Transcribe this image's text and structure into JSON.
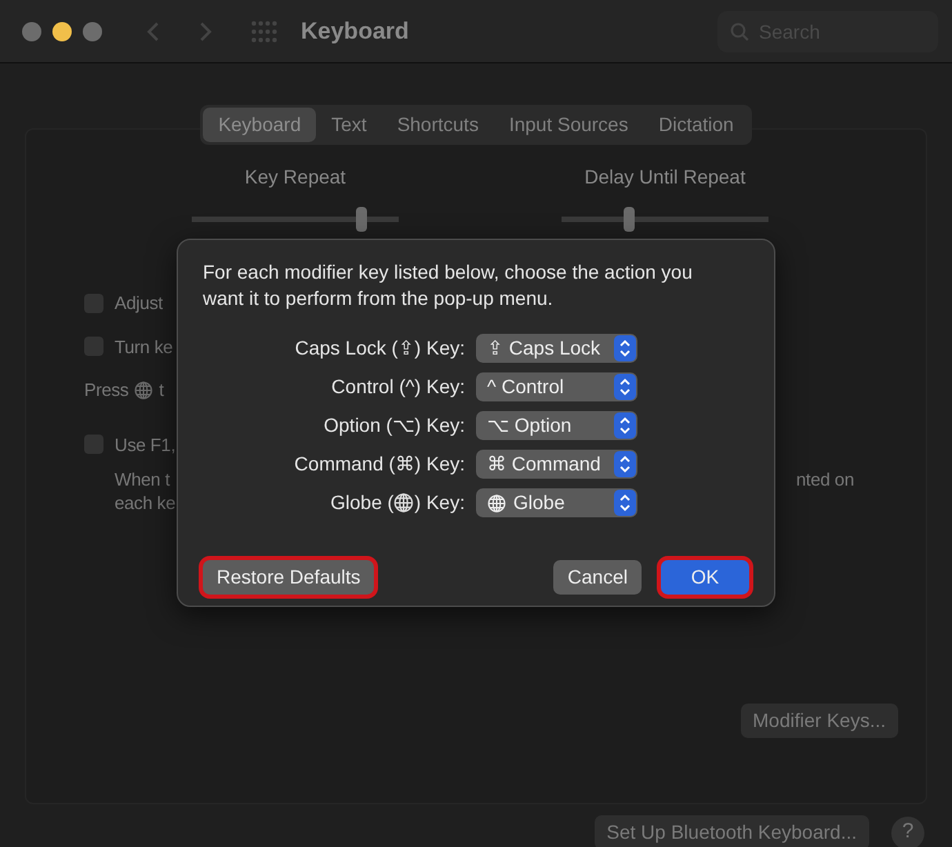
{
  "window": {
    "title": "Keyboard",
    "search": {
      "placeholder": "Search"
    }
  },
  "tabs": [
    {
      "label": "Keyboard",
      "selected": true
    },
    {
      "label": "Text",
      "selected": false
    },
    {
      "label": "Shortcuts",
      "selected": false
    },
    {
      "label": "Input Sources",
      "selected": false
    },
    {
      "label": "Dictation",
      "selected": false
    }
  ],
  "sliders": [
    {
      "label": "Key Repeat",
      "level": 0.84
    },
    {
      "label": "Delay Until Repeat",
      "level": 0.32
    }
  ],
  "background_options": [
    {
      "kind": "checkbox",
      "text": "Adjust",
      "checked": false
    },
    {
      "kind": "checkbox",
      "text": "Turn ke",
      "checked": false
    },
    {
      "kind": "globe_line",
      "text": "Press",
      "text_end": "t"
    },
    {
      "kind": "checkbox",
      "text": "Use F1,",
      "checked": false,
      "note_lines": [
        "When t",
        "each ke"
      ],
      "note_right": "nted on"
    }
  ],
  "buttons": {
    "modifier_keys": "Modifier Keys...",
    "bluetooth": "Set Up Bluetooth Keyboard...",
    "help": "?"
  },
  "dialog": {
    "message": "For each modifier key listed below, choose the action you want it to perform from the pop-up menu.",
    "rows": [
      {
        "kind": "symbol",
        "label": "Caps Lock (⇪) Key:",
        "value": "⇪ Caps Lock"
      },
      {
        "kind": "symbol",
        "label": "Control (^) Key:",
        "value": "^ Control"
      },
      {
        "kind": "symbol",
        "label": "Option (⌥) Key:",
        "value": "⌥ Option"
      },
      {
        "kind": "symbol",
        "label": "Command (⌘) Key:",
        "value": "⌘ Command"
      },
      {
        "kind": "globe",
        "label": "Globe (",
        "label_end": ") Key:",
        "value": "Globe"
      }
    ],
    "buttons": [
      {
        "label": "Restore Defaults",
        "default": false,
        "highlighted": true
      },
      {
        "label": "Cancel",
        "default": false,
        "highlighted": false
      },
      {
        "label": "OK",
        "default": true,
        "highlighted": true
      }
    ]
  }
}
